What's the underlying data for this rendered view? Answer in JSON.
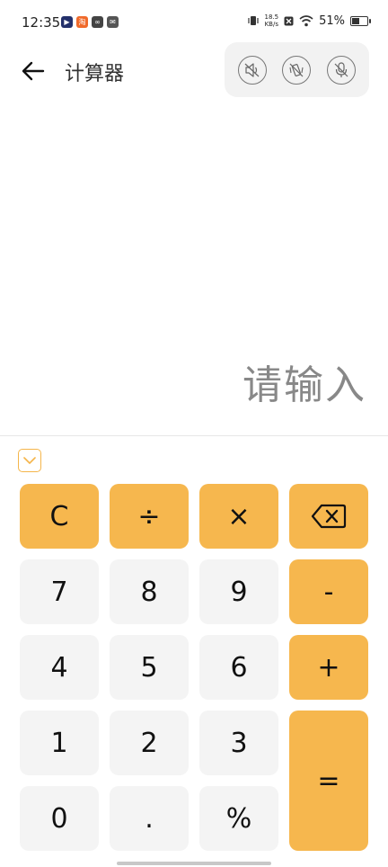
{
  "status_bar": {
    "time": "12:35",
    "net_speed_value": "18.5",
    "net_speed_unit": "KB/s",
    "battery": "51%",
    "battery_level": 0.51
  },
  "header": {
    "title": "计算器"
  },
  "display": {
    "placeholder": "请输入"
  },
  "keypad": {
    "clear": "C",
    "divide": "÷",
    "multiply": "×",
    "seven": "7",
    "eight": "8",
    "nine": "9",
    "minus": "-",
    "four": "4",
    "five": "5",
    "six": "6",
    "plus": "+",
    "one": "1",
    "two": "2",
    "three": "3",
    "equals": "=",
    "zero": "0",
    "dot": ".",
    "percent": "%"
  },
  "colors": {
    "accent": "#f6b74e",
    "key_bg": "#f4f4f4",
    "toolbar_bg": "#f2f2f2"
  },
  "icons": {
    "back": "arrow-left-icon",
    "speaker_muted": "speaker-muted-icon",
    "vibrate_off": "vibrate-off-icon",
    "mic_off": "mic-off-icon",
    "backspace": "backspace-icon",
    "collapse": "chevron-down-icon"
  }
}
